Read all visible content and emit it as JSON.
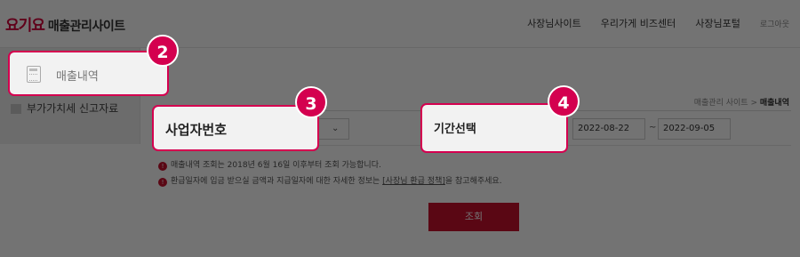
{
  "header": {
    "brand": "요기요",
    "title": "매출관리사이트",
    "nav": [
      "사장님사이트",
      "우리가게 비즈센터",
      "사장님포털"
    ],
    "logout": "로그아웃"
  },
  "sidebar": {
    "items": [
      {
        "label": "매출내역"
      },
      {
        "label": "부가가치세 신고자료"
      }
    ]
  },
  "breadcrumb": {
    "parent": "매출관리 사이트",
    "separator": ">",
    "current": "매출내역"
  },
  "form": {
    "business_number_label": "사업자번호",
    "period_label": "기간선택",
    "date_from": "2022-08-22",
    "date_separator": "~",
    "date_to": "2022-09-05",
    "search_button": "조회"
  },
  "notices": {
    "line1": "매출내역 조회는 2018년 6월 16일 이후부터 조회 가능합니다.",
    "line2_prefix": "환급일자에 입금 받으실 금액과 지급일자에 대한 자세한 정보는 ",
    "line2_link": "[사장님 환급 정책]",
    "line2_suffix": "을 참고해주세요."
  },
  "callouts": [
    {
      "number": "2",
      "label": "매출내역",
      "icon": "calculator-icon"
    },
    {
      "number": "3",
      "label": "사업자번호"
    },
    {
      "number": "4",
      "label": "기간선택"
    }
  ],
  "colors": {
    "accent": "#d4004f",
    "brand": "#d4003b",
    "button": "#c8102e"
  }
}
